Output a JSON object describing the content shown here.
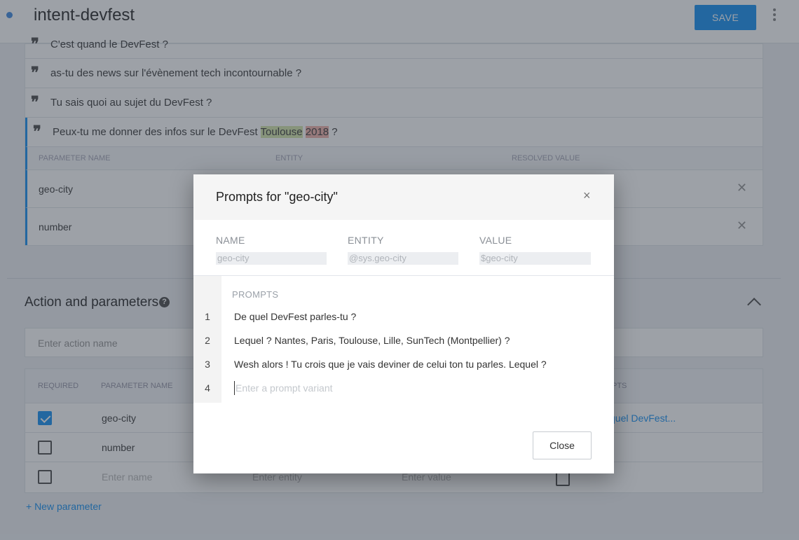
{
  "header": {
    "title": "intent-devfest",
    "save_label": "SAVE"
  },
  "training_phrases": [
    {
      "text": "C'est quand le DevFest ?"
    },
    {
      "text": "as-tu des news sur l'évènement tech incontournable ?"
    },
    {
      "text": "Tu sais quoi au sujet du DevFest ?"
    },
    {
      "text_before": "Peux-tu me donner des infos sur le DevFest ",
      "highlight_city": "Toulouse",
      "space": " ",
      "highlight_number": "2018",
      "text_after": " ?"
    }
  ],
  "annotation_table": {
    "headers": [
      "PARAMETER NAME",
      "ENTITY",
      "RESOLVED VALUE"
    ],
    "rows": [
      {
        "name": "geo-city"
      },
      {
        "name": "number"
      }
    ]
  },
  "action_section": {
    "title": "Action and parameters",
    "action_placeholder": "Enter action name"
  },
  "params_table": {
    "headers": {
      "required": "REQUIRED",
      "parameter_name": "PARAMETER NAME",
      "prompts": "PTS"
    },
    "rows": [
      {
        "required": true,
        "name": "geo-city",
        "prompt_link": "quel DevFest..."
      },
      {
        "required": false,
        "name": "number"
      },
      {
        "required": false,
        "name_placeholder": "Enter name",
        "entity_placeholder": "Enter entity",
        "value_placeholder": "Enter value"
      }
    ],
    "new_parameter_label": "+ New parameter"
  },
  "dialog": {
    "title": "Prompts for \"geo-city\"",
    "close_icon": "×",
    "fields": {
      "name_label": "NAME",
      "name_value": "geo-city",
      "entity_label": "ENTITY",
      "entity_value": "@sys.geo-city",
      "value_label": "VALUE",
      "value_value": "$geo-city"
    },
    "prompts_label": "PROMPTS",
    "prompts": [
      {
        "num": "1",
        "text": "De quel DevFest parles-tu ?"
      },
      {
        "num": "2",
        "text": "Lequel ? Nantes, Paris, Toulouse, Lille, SunTech (Montpellier) ?"
      },
      {
        "num": "3",
        "text": "Wesh alors ! Tu crois que je vais deviner de celui ton tu parles. Lequel ?"
      }
    ],
    "new_prompt": {
      "num": "4",
      "placeholder": "Enter a prompt variant"
    },
    "close_label": "Close"
  },
  "colors": {
    "accent": "#2196f3",
    "city_highlight": "#d7e8b0",
    "number_highlight": "#f3b6b0"
  }
}
